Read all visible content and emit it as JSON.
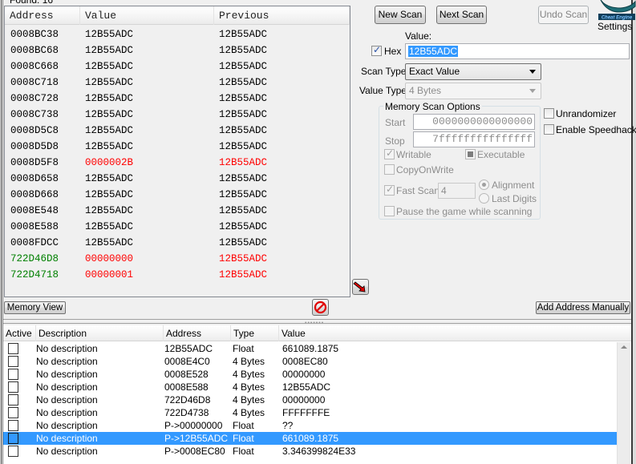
{
  "found_label": "Found: 16",
  "results": {
    "columns": [
      "Address",
      "Value",
      "Previous"
    ],
    "rows": [
      {
        "address": "0008BC38",
        "value": "12B55ADC",
        "previous": "12B55ADC",
        "addr_color": "#000000",
        "val_color": "#000000",
        "prev_color": "#000000"
      },
      {
        "address": "0008BC68",
        "value": "12B55ADC",
        "previous": "12B55ADC",
        "addr_color": "#000000",
        "val_color": "#000000",
        "prev_color": "#000000"
      },
      {
        "address": "0008C668",
        "value": "12B55ADC",
        "previous": "12B55ADC",
        "addr_color": "#000000",
        "val_color": "#000000",
        "prev_color": "#000000"
      },
      {
        "address": "0008C718",
        "value": "12B55ADC",
        "previous": "12B55ADC",
        "addr_color": "#000000",
        "val_color": "#000000",
        "prev_color": "#000000"
      },
      {
        "address": "0008C728",
        "value": "12B55ADC",
        "previous": "12B55ADC",
        "addr_color": "#000000",
        "val_color": "#000000",
        "prev_color": "#000000"
      },
      {
        "address": "0008C738",
        "value": "12B55ADC",
        "previous": "12B55ADC",
        "addr_color": "#000000",
        "val_color": "#000000",
        "prev_color": "#000000"
      },
      {
        "address": "0008D5C8",
        "value": "12B55ADC",
        "previous": "12B55ADC",
        "addr_color": "#000000",
        "val_color": "#000000",
        "prev_color": "#000000"
      },
      {
        "address": "0008D5D8",
        "value": "12B55ADC",
        "previous": "12B55ADC",
        "addr_color": "#000000",
        "val_color": "#000000",
        "prev_color": "#000000"
      },
      {
        "address": "0008D5F8",
        "value": "0000002B",
        "previous": "12B55ADC",
        "addr_color": "#000000",
        "val_color": "#ff0000",
        "prev_color": "#ff0000"
      },
      {
        "address": "0008D658",
        "value": "12B55ADC",
        "previous": "12B55ADC",
        "addr_color": "#000000",
        "val_color": "#000000",
        "prev_color": "#000000"
      },
      {
        "address": "0008D668",
        "value": "12B55ADC",
        "previous": "12B55ADC",
        "addr_color": "#000000",
        "val_color": "#000000",
        "prev_color": "#000000"
      },
      {
        "address": "0008E548",
        "value": "12B55ADC",
        "previous": "12B55ADC",
        "addr_color": "#000000",
        "val_color": "#000000",
        "prev_color": "#000000"
      },
      {
        "address": "0008E588",
        "value": "12B55ADC",
        "previous": "12B55ADC",
        "addr_color": "#000000",
        "val_color": "#000000",
        "prev_color": "#000000"
      },
      {
        "address": "0008FDCC",
        "value": "12B55ADC",
        "previous": "12B55ADC",
        "addr_color": "#000000",
        "val_color": "#000000",
        "prev_color": "#000000"
      },
      {
        "address": "722D46D8",
        "value": "00000000",
        "previous": "12B55ADC",
        "addr_color": "#008000",
        "val_color": "#ff0000",
        "prev_color": "#ff0000"
      },
      {
        "address": "722D4718",
        "value": "00000001",
        "previous": "12B55ADC",
        "addr_color": "#008000",
        "val_color": "#ff0000",
        "prev_color": "#ff0000"
      }
    ]
  },
  "scan": {
    "new_scan": "New Scan",
    "next_scan": "Next Scan",
    "undo_scan": "Undo Scan",
    "settings": "Settings",
    "logo_text": "Cheat Engine",
    "value_label": "Value:",
    "hex_label": "Hex",
    "hex_checked": true,
    "value_input": "12B55ADC",
    "scan_type_label": "Scan Type",
    "scan_type_value": "Exact Value",
    "value_type_label": "Value Type",
    "value_type_value": "4 Bytes"
  },
  "memory_scan_options": {
    "title": "Memory Scan Options",
    "start_label": "Start",
    "start_value": "0000000000000000",
    "stop_label": "Stop",
    "stop_value": "7fffffffffffffff",
    "writable": "Writable",
    "executable": "Executable",
    "copy_on_write": "CopyOnWrite",
    "fast_scan": "Fast Scan",
    "fast_scan_value": "4",
    "alignment": "Alignment",
    "last_digits": "Last Digits",
    "pause_game": "Pause the game while scanning"
  },
  "extras": {
    "unrandomizer": "Unrandomizer",
    "speedhack": "Enable Speedhack"
  },
  "bottom_bar": {
    "memory_view": "Memory View",
    "add_address_manually": "Add Address Manually"
  },
  "address_table": {
    "columns": [
      "Active",
      "Description",
      "Address",
      "Type",
      "Value"
    ],
    "rows": [
      {
        "description": "No description",
        "address": "12B55ADC",
        "type": "Float",
        "value": "661089.1875",
        "selected": false
      },
      {
        "description": "No description",
        "address": "0008E4C0",
        "type": "4 Bytes",
        "value": "0008EC80",
        "selected": false
      },
      {
        "description": "No description",
        "address": "0008E528",
        "type": "4 Bytes",
        "value": "00000000",
        "selected": false
      },
      {
        "description": "No description",
        "address": "0008E588",
        "type": "4 Bytes",
        "value": "12B55ADC",
        "selected": false
      },
      {
        "description": "No description",
        "address": "722D46D8",
        "type": "4 Bytes",
        "value": "00000000",
        "selected": false
      },
      {
        "description": "No description",
        "address": "722D4738",
        "type": "4 Bytes",
        "value": "FFFFFFFE",
        "selected": false
      },
      {
        "description": "No description",
        "address": "P->00000000",
        "type": "Float",
        "value": "??",
        "selected": false
      },
      {
        "description": "No description",
        "address": "P->12B55ADC",
        "type": "Float",
        "value": "661089.1875",
        "selected": true
      },
      {
        "description": "No description",
        "address": "P->0008EC80",
        "type": "Float",
        "value": "3.346399824E33",
        "selected": false
      }
    ]
  },
  "colors": {
    "selection": "#3399ff",
    "changed_value": "#ff0000",
    "static_address": "#008000"
  }
}
